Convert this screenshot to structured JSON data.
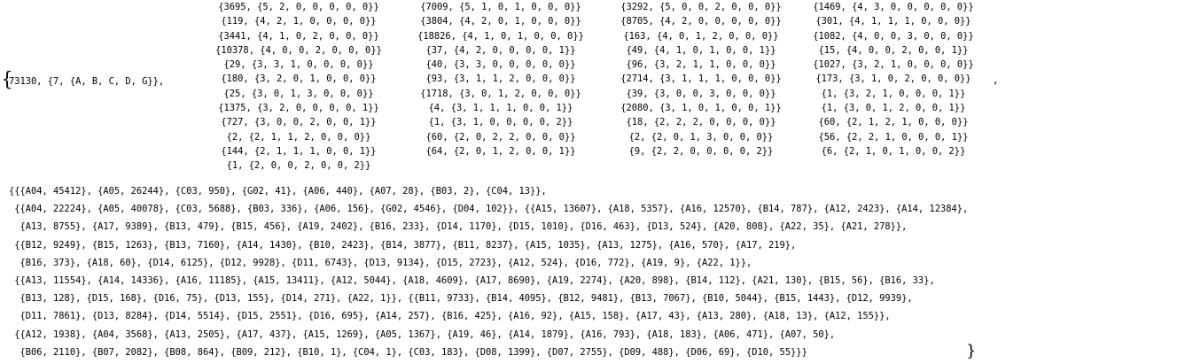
{
  "brace_open": "{",
  "brace_close": "}",
  "prefix": "73130, {7, {A, B, C, D, G}},",
  "separator": ",",
  "columns": [
    [
      "{3695, {5, 2, 0, 0, 0, 0, 0}}",
      "{119, {4, 2, 1, 0, 0, 0, 0}}",
      "{3441, {4, 1, 0, 2, 0, 0, 0}}",
      "{10378, {4, 0, 0, 2, 0, 0, 0}}",
      "{29, {3, 3, 1, 0, 0, 0, 0}}",
      "{180, {3, 2, 0, 1, 0, 0, 0}}",
      "{25, {3, 0, 1, 3, 0, 0, 0}}",
      "{1375, {3, 2, 0, 0, 0, 0, 1}}",
      "{727, {3, 0, 0, 2, 0, 0, 1}}",
      "{2, {2, 1, 1, 2, 0, 0, 0}}",
      "{144, {2, 1, 1, 1, 0, 0, 1}}",
      "{1, {2, 0, 0, 2, 0, 0, 2}}"
    ],
    [
      "{7009, {5, 1, 0, 1, 0, 0, 0}}",
      "{3804, {4, 2, 0, 1, 0, 0, 0}}",
      "{18826, {4, 1, 0, 1, 0, 0, 0}}",
      "{37, {4, 2, 0, 0, 0, 0, 1}}",
      "{40, {3, 3, 0, 0, 0, 0, 0}}",
      "{93, {3, 1, 1, 2, 0, 0, 0}}",
      "{1718, {3, 0, 1, 2, 0, 0, 0}}",
      "{4, {3, 1, 1, 1, 0, 0, 1}}",
      "{1, {3, 1, 0, 0, 0, 0, 2}}",
      "{60, {2, 0, 2, 2, 0, 0, 0}}",
      "{64, {2, 0, 1, 2, 0, 0, 1}}"
    ],
    [
      "{3292, {5, 0, 0, 2, 0, 0, 0}}",
      "{8705, {4, 2, 0, 0, 0, 0, 0}}",
      "{163, {4, 0, 1, 2, 0, 0, 0}}",
      "{49, {4, 1, 0, 1, 0, 0, 1}}",
      "{96, {3, 2, 1, 1, 0, 0, 0}}",
      "{2714, {3, 1, 1, 1, 0, 0, 0}}",
      "{39, {3, 0, 0, 3, 0, 0, 0}}",
      "{2080, {3, 1, 0, 1, 0, 0, 1}}",
      "{18, {2, 2, 2, 0, 0, 0, 0}}",
      "{2, {2, 0, 1, 3, 0, 0, 0}}",
      "{9, {2, 2, 0, 0, 0, 0, 2}}"
    ],
    [
      "{1469, {4, 3, 0, 0, 0, 0, 0}}",
      "{301, {4, 1, 1, 1, 0, 0, 0}}",
      "{1082, {4, 0, 0, 3, 0, 0, 0}}",
      "{15, {4, 0, 0, 2, 0, 0, 1}}",
      "{1027, {3, 2, 1, 0, 0, 0, 0}}",
      "{173, {3, 1, 0, 2, 0, 0, 0}}",
      "{1, {3, 2, 1, 0, 0, 0, 1}}",
      "{1, {3, 0, 1, 2, 0, 0, 1}}",
      "{60, {2, 1, 2, 1, 0, 0, 0}}",
      "{56, {2, 2, 1, 0, 0, 0, 1}}",
      "{6, {2, 1, 0, 1, 0, 0, 2}}"
    ]
  ],
  "lines": [
    "{{{A04, 45412}, {A05, 26244}, {C03, 950}, {G02, 41}, {A06, 440}, {A07, 28}, {B03, 2}, {C04, 13}},",
    " {{A04, 22224}, {A05, 40078}, {C03, 5688}, {B03, 336}, {A06, 156}, {G02, 4546}, {D04, 102}}, {{A15, 13607}, {A18, 5357}, {A16, 12570}, {B14, 787}, {A12, 2423}, {A14, 12384},",
    "  {A13, 8755}, {A17, 9389}, {B13, 479}, {B15, 456}, {A19, 2402}, {B16, 233}, {D14, 1170}, {D15, 1010}, {D16, 463}, {D13, 524}, {A20, 808}, {A22, 35}, {A21, 278}},",
    " {{B12, 9249}, {B15, 1263}, {B13, 7160}, {A14, 1430}, {B10, 2423}, {B14, 3877}, {B11, 8237}, {A15, 1035}, {A13, 1275}, {A16, 570}, {A17, 219},",
    "  {B16, 373}, {A18, 60}, {D14, 6125}, {D12, 9928}, {D11, 6743}, {D13, 9134}, {D15, 2723}, {A12, 524}, {D16, 772}, {A19, 9}, {A22, 1}},",
    " {{A13, 11554}, {A14, 14336}, {A16, 11185}, {A15, 13411}, {A12, 5044}, {A18, 4609}, {A17, 8690}, {A19, 2274}, {A20, 898}, {B14, 112}, {A21, 130}, {B15, 56}, {B16, 33},",
    "  {B13, 128}, {D15, 168}, {D16, 75}, {D13, 155}, {D14, 271}, {A22, 1}}, {{B11, 9733}, {B14, 4095}, {B12, 9481}, {B13, 7067}, {B10, 5044}, {B15, 1443}, {D12, 9939},",
    "  {D11, 7861}, {D13, 8284}, {D14, 5514}, {D15, 2551}, {D16, 695}, {A14, 257}, {B16, 425}, {A16, 92}, {A15, 158}, {A17, 43}, {A13, 280}, {A18, 13}, {A12, 155}},",
    " {{A12, 1938}, {A04, 3568}, {A13, 2505}, {A17, 437}, {A15, 1269}, {A05, 1367}, {A19, 46}, {A14, 1879}, {A16, 793}, {A18, 183}, {A06, 471}, {A07, 50},",
    "  {B06, 2110}, {B07, 2082}, {B08, 864}, {B09, 212}, {B10, 1}, {C04, 1}, {C03, 183}, {D08, 1399}, {D07, 2755}, {D09, 488}, {D06, 69}, {D10, 55}}}"
  ]
}
